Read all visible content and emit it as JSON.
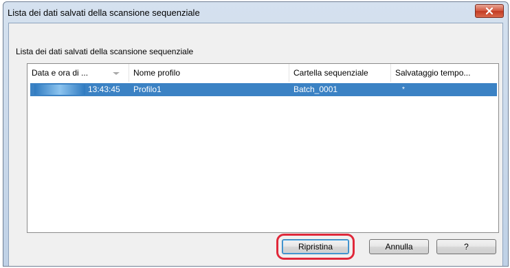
{
  "dialog": {
    "title": "Lista dei dati salvati della scansione sequenziale",
    "group_label": "Lista dei dati salvati della scansione sequenziale"
  },
  "list": {
    "columns": [
      "Data e ora di ...",
      "Nome profilo",
      "Cartella sequenziale",
      "Salvataggio tempo..."
    ],
    "rows": [
      {
        "time": "13:43:45",
        "profile": "Profilo1",
        "folder": "Batch_0001",
        "temp": "*",
        "selected": true
      }
    ]
  },
  "buttons": {
    "restore": "Ripristina",
    "cancel": "Annulla",
    "help": "?"
  },
  "colors": {
    "selection": "#3b82c4",
    "highlight_ring": "#e0283a",
    "close_button": "#c23a22"
  },
  "icons": {
    "close": "close-icon",
    "sort": "sort-descending-icon"
  }
}
